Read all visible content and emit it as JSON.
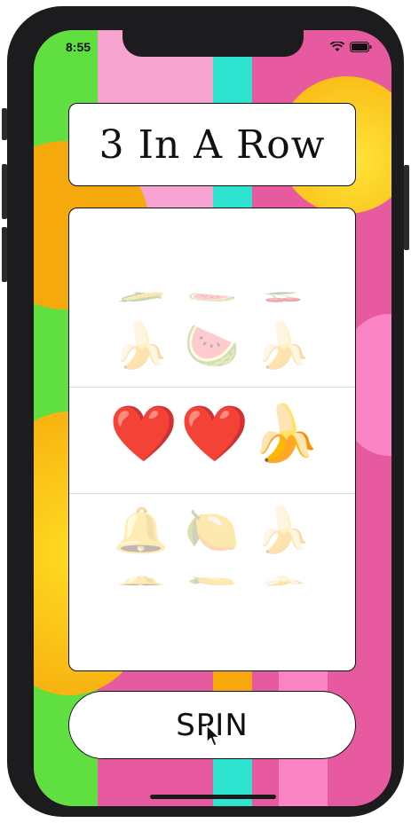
{
  "status_bar": {
    "time": "8:55"
  },
  "title": "3 In A Row",
  "reels": {
    "above_squashed": [
      "🌽",
      "🍉",
      "🍒"
    ],
    "above": [
      "🍌",
      "🍉",
      "🍌"
    ],
    "middle": [
      "❤️",
      "❤️",
      "🍌"
    ],
    "below": [
      "🔔",
      "🍋",
      "🍌"
    ],
    "below_squashed": [
      "🔔",
      "🍋",
      "🍌"
    ]
  },
  "spin_label": "SPIN",
  "colors": {
    "green": "#5fe040",
    "pink_light": "#f7a3cf",
    "teal": "#2ee3cf",
    "magenta": "#e75aa0",
    "orange": "#f7a80c",
    "yellow": "#ffd21f"
  }
}
